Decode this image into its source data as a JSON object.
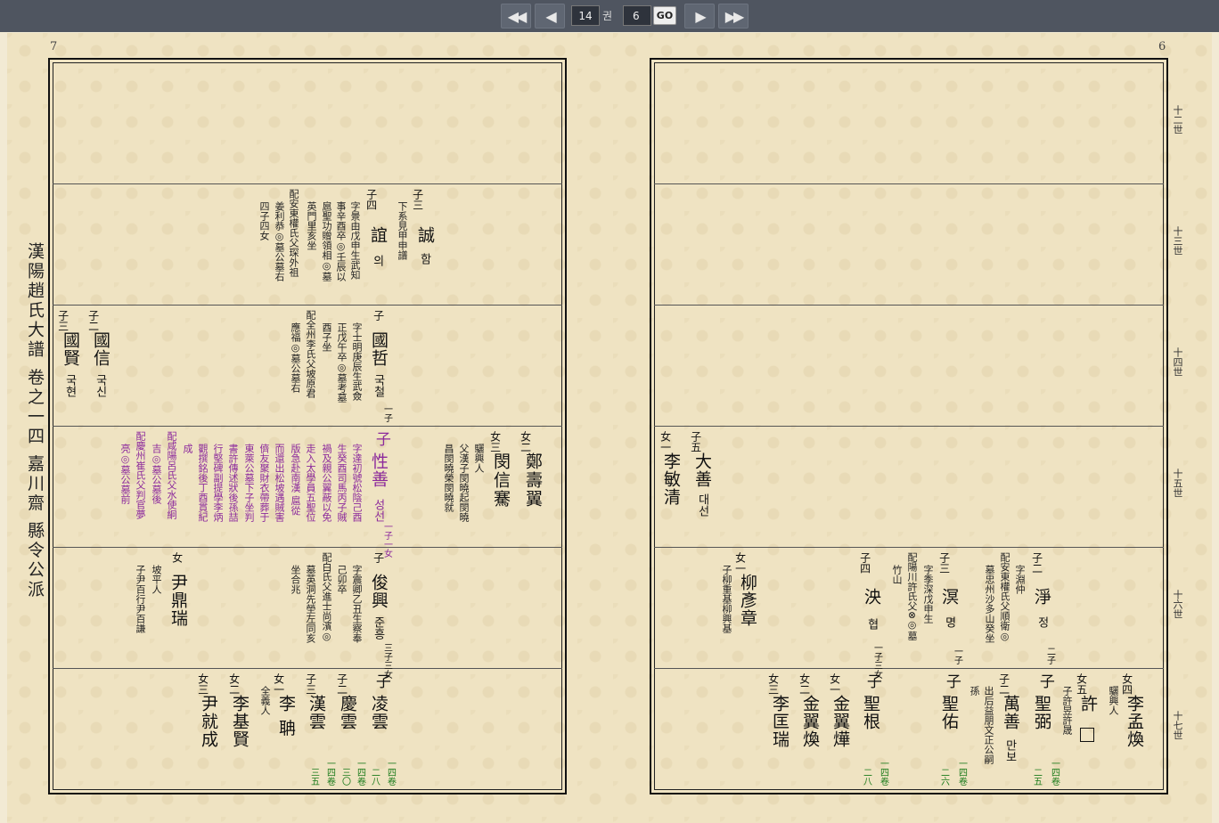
{
  "toolbar": {
    "first_label": "first-page-icon",
    "prev_label": "prev-page-icon",
    "next_label": "next-page-icon",
    "last_label": "last-page-icon",
    "volume_value": "14",
    "volume_unit": "권",
    "page_value": "6",
    "go_label": "GO"
  },
  "page_numbers": {
    "left": "7",
    "right": "6"
  },
  "book_title": "漢陽趙氏大譜 卷之一四 嘉川齋 縣令公派",
  "generations": [
    "十二世",
    "十三世",
    "十四世",
    "十五世",
    "十六世",
    "十七世"
  ],
  "left_page": {
    "r13_rel1": "子三",
    "r13_name1": "誠",
    "r13_kor1": "함",
    "r13_det1a": "下系見甲申譜",
    "r13_rel2": "子四",
    "r13_name2": "誼",
    "r13_kor2": "의",
    "r13_det2a": "字景由戊申生武知",
    "r13_det2b": "事辛酉卒◎壬辰以",
    "r13_det2c": "扈聖功贈領相◎墓",
    "r13_det2d": "英門里亥坐",
    "r13_det2e": "配安東權氏父琛外祖",
    "r13_det2f": "姜利恭◎墓公墓右",
    "r13_det2g": "四子四女",
    "r14_rel1": "子",
    "r14_name1": "國哲",
    "r14_kor1": "국철",
    "r14_sub1": "一子",
    "r14_det1a": "字士明庚辰生武僉",
    "r14_det1b": "正戊午卒◎墓考墓",
    "r14_det1c": "酉子坐",
    "r14_det1d": "配全州李氏父坡原君",
    "r14_det1e": "應福◎墓公墓右",
    "r14_rel2": "子二",
    "r14_name2": "國信",
    "r14_kor2": "국신",
    "r14_rel3": "子三",
    "r14_name3": "國賢",
    "r14_kor3": "국현",
    "r15_rel1": "女二",
    "r15_name1": "鄭壽翼",
    "r15_rel2": "女三",
    "r15_name2": "閔信騫",
    "r15_det2a": "驪興人",
    "r15_det2b": "父漢子閔曉起閔曉",
    "r15_det2c": "昌閔曉榮閔曉就",
    "r15_rel3": "子",
    "r15_name3": "性善",
    "r15_kor3": "성선",
    "r15_sub3": "一子一女",
    "r15_det3a": "字達初號松陰己酉",
    "r15_det3b": "生癸酉司馬丙子賊",
    "r15_det3c": "禍及親公翼蔽以免",
    "r15_det3d": "走入太學員五聖位",
    "r15_det3e": "版急赴南漢 扈從",
    "r15_det3f": "而還出松坡遇賊害",
    "r15_det3g": "儕友聚財衣帶葬于",
    "r15_det3h": "東萊公墓下子坐判",
    "r15_det3i": "書許傳述狀後孫喆",
    "r15_det3j": "行堅碑副提學李炳",
    "r15_det3k": "觀撰銘後丁酉貫紀",
    "r15_det3l": "成",
    "r15_det3m": "配咸陽呂氏父水使絅",
    "r15_det3n": "吉◎墓公墓後",
    "r15_det3o": "配慶州崔氏父判官夢",
    "r15_det3p": "亮◎墓公墓前",
    "r16_rel1": "子",
    "r16_name1": "俊興",
    "r16_kor1": "준흥",
    "r16_sub1": "三子三女",
    "r16_det1a": "字震卿乙丑生察奉",
    "r16_det1b": "己卯卒",
    "r16_det1c": "配白氏父進士尚濱◎",
    "r16_det1d": "墓英洞先塋左同亥",
    "r16_det1e": "坐合兆",
    "r16_rel2": "女",
    "r16_name2": "尹鼎瑞",
    "r16_det2a": "坡平人",
    "r16_det2b": "子尹百行尹百謙",
    "r17_rel1": "子",
    "r17_name1": "凌雲",
    "r17_ref1": "一四卷",
    "r17_ref1b": "二八",
    "r17_rel2": "子二",
    "r17_name2": "慶雲",
    "r17_ref2": "一四卷",
    "r17_ref2b": "三〇",
    "r17_rel3": "子三",
    "r17_name3": "漢雲",
    "r17_ref3": "一四卷",
    "r17_ref3b": "三五",
    "r17_rel4": "女一",
    "r17_name4": "李 聃",
    "r17_det4": "全義人",
    "r17_rel5": "女二",
    "r17_name5": "李基賢",
    "r17_rel6": "女三",
    "r17_name6": "尹就成"
  },
  "right_page": {
    "r15_rel1": "子五",
    "r15_name1": "大善",
    "r15_kor1": "대선",
    "r15_rel2": "女一",
    "r15_name2": "李敏清",
    "r16_rel1": "子二",
    "r16_name1": "淨",
    "r16_kor1": "정",
    "r16_sub1": "二子",
    "r16_det1a": "字淵仲",
    "r16_det1b": "配安東權氏父順衛◎",
    "r16_det1c": "墓忠州沙多山癸坐",
    "r16_rel2": "子三",
    "r16_name2": "溟",
    "r16_kor2": "명",
    "r16_sub2": "一子",
    "r16_det2a": "字季深戊申生",
    "r16_det2b": "配陽川許氏父⊗◎墓",
    "r16_det2c": "竹山",
    "r16_rel3": "子四",
    "r16_name3": "泱",
    "r16_kor3": "협",
    "r16_sub3": "一子三女",
    "r16_rel4": "女一",
    "r16_name4": "柳彥章",
    "r16_det4": "子柳重基柳興基",
    "r17_rel1": "女四",
    "r17_name1": "李孟煥",
    "r17_det1": "驪興人",
    "r17_rel2": "女五",
    "r17_name2": "許",
    "r17_det2": "子許昱許晟",
    "r17_rel3": "子",
    "r17_name3": "聖弼",
    "r17_ref3": "一四卷",
    "r17_ref3b": "二五",
    "r17_rel4": "子二",
    "r17_name4": "萬善",
    "r17_kor4": "만보",
    "r17_det4": "出后益朋文正公嗣",
    "r17_det4b": "孫",
    "r17_rel5": "子",
    "r17_name5": "聖佑",
    "r17_ref5": "一四卷",
    "r17_ref5b": "二六",
    "r17_rel6": "子",
    "r17_name6": "聖根",
    "r17_ref6": "一四卷",
    "r17_ref6b": "二八",
    "r17_rel7": "女一",
    "r17_name7": "金翼燁",
    "r17_rel8": "女二",
    "r17_name8": "金翼煥",
    "r17_rel9": "女三",
    "r17_name9": "李匡瑞"
  },
  "colors": {
    "toolbar": "#4f5560",
    "paper": "#efe3c2",
    "purple": "#8c2a9c",
    "green": "#1a7a1a"
  }
}
